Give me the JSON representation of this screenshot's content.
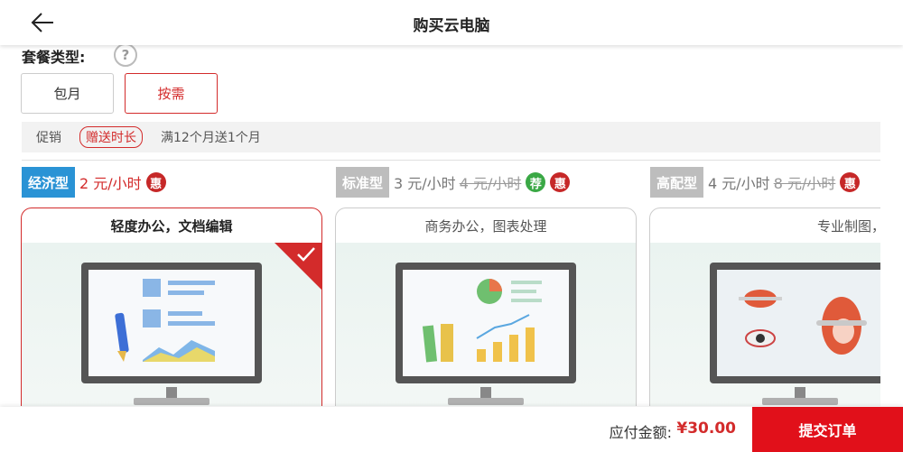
{
  "header": {
    "title": "购买云电脑",
    "back_icon": "arrow-left-icon"
  },
  "package": {
    "label": "套餐类型:",
    "help_symbol": "?",
    "options": [
      {
        "label": "包月",
        "selected": false
      },
      {
        "label": "按需",
        "selected": true
      }
    ]
  },
  "promo": {
    "label": "促销",
    "tag": "赠送时长",
    "desc": "满12个月送1个月"
  },
  "tiers": [
    {
      "name": "经济型",
      "price": "2 元/小时",
      "old_price": "",
      "badges": [
        "惠"
      ],
      "selected": true
    },
    {
      "name": "标准型",
      "price": "3 元/小时",
      "old_price": "4 元/小时",
      "badges": [
        "荐",
        "惠"
      ],
      "selected": false
    },
    {
      "name": "高配型",
      "price": "4 元/小时",
      "old_price": "8 元/小时",
      "badges": [
        "惠"
      ],
      "selected": false
    }
  ],
  "cards": [
    {
      "title": "轻度办公，文档编辑"
    },
    {
      "title": "商务办公，图表处理"
    },
    {
      "title": "专业制图，游戏娱乐"
    }
  ],
  "footer": {
    "pay_label": "应付金额:",
    "pay_amount": "¥30.00",
    "submit_label": "提交订单"
  },
  "colors": {
    "accent": "#d32b2b",
    "tier_selected": "#2a93d5",
    "submit": "#e1101a"
  }
}
